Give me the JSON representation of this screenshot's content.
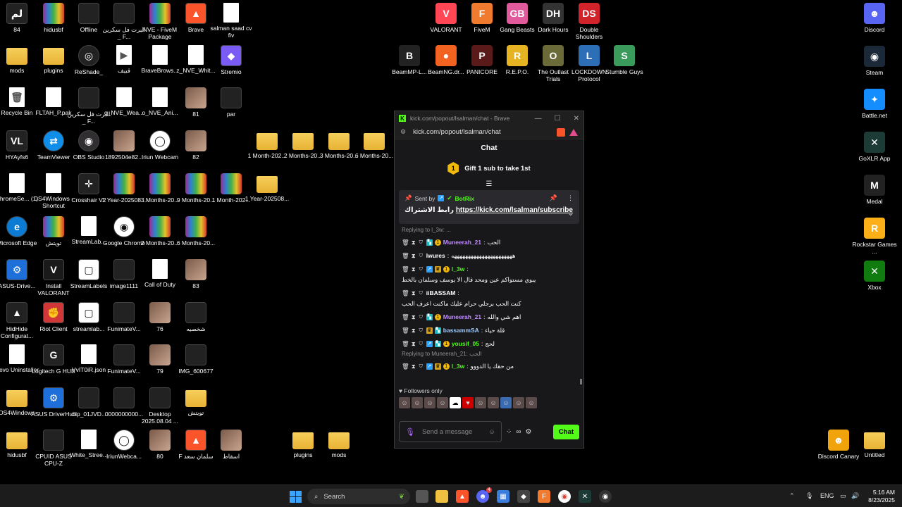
{
  "desktop": {
    "icons_left": [
      {
        "label": "84",
        "glyph": "لم",
        "type": "dark"
      },
      {
        "label": "hidusbf",
        "glyph": "",
        "type": "rar"
      },
      {
        "label": "Offline",
        "glyph": "",
        "type": "dark"
      },
      {
        "label": "البرت فل سكرين _ F...",
        "glyph": "",
        "type": "dark"
      },
      {
        "label": "NVE - FiveM Package",
        "glyph": "",
        "type": "rar"
      },
      {
        "label": "Brave",
        "glyph": "▲",
        "type": "brave"
      },
      {
        "label": "salman saad cv fiv",
        "glyph": "",
        "type": "file"
      },
      {
        "label": "mods",
        "glyph": "",
        "type": "folder"
      },
      {
        "label": "plugins",
        "glyph": "",
        "type": "folder"
      },
      {
        "label": "ReShade_",
        "glyph": "◎",
        "type": "reshade"
      },
      {
        "label": "قبيف",
        "glyph": "▶",
        "type": "file"
      },
      {
        "label": "BraveBrows...",
        "glyph": "",
        "type": "file"
      },
      {
        "label": "z_NVE_Whit...",
        "glyph": "",
        "type": "file"
      },
      {
        "label": "Stremio",
        "glyph": "◆",
        "type": "stremio"
      },
      {
        "label": "Recycle Bin",
        "glyph": "🗑",
        "type": "file"
      },
      {
        "label": "FLTAH_P.pak",
        "glyph": "",
        "type": "file"
      },
      {
        "label": "البرت فل سكرين _ F...",
        "glyph": "",
        "type": "dark"
      },
      {
        "label": "q_NVE_Wea...",
        "glyph": "",
        "type": "file"
      },
      {
        "label": "o_NVE_Ani...",
        "glyph": "",
        "type": "file"
      },
      {
        "label": "81",
        "glyph": "",
        "type": "photo"
      },
      {
        "label": "par",
        "glyph": "",
        "type": "dark"
      },
      {
        "label": "HYAyfs6",
        "glyph": "VL",
        "type": "dark"
      },
      {
        "label": "TeamViewer",
        "glyph": "⇄",
        "type": "teamviewer"
      },
      {
        "label": "OBS Studio",
        "glyph": "◉",
        "type": "obs"
      },
      {
        "label": "1892504e82...",
        "glyph": "",
        "type": "photo"
      },
      {
        "label": "Iriun Webcam",
        "glyph": "◯",
        "type": "iriun"
      },
      {
        "label": "82",
        "glyph": "",
        "type": "photo"
      },
      {
        "label": "ChromeSe... (1)",
        "glyph": "",
        "type": "file"
      },
      {
        "label": "DS4Windows - Shortcut",
        "glyph": "",
        "type": "file"
      },
      {
        "label": "Crosshair V2",
        "glyph": "✛",
        "type": "dark"
      },
      {
        "label": "1 Year-202508...",
        "glyph": "",
        "type": "rar"
      },
      {
        "label": "3 Months-20...",
        "glyph": "",
        "type": "rar"
      },
      {
        "label": "9 Months-20...",
        "glyph": "",
        "type": "rar"
      },
      {
        "label": "1 Month-202...",
        "glyph": "",
        "type": "rar"
      },
      {
        "label": "1 Year-202508...",
        "glyph": "",
        "type": "folder"
      },
      {
        "label": "Microsoft Edge",
        "glyph": "e",
        "type": "edge"
      },
      {
        "label": "تويتش",
        "glyph": "",
        "type": "rar"
      },
      {
        "label": "StreamLab...",
        "glyph": "",
        "type": "file"
      },
      {
        "label": "Google Chrome",
        "glyph": "◉",
        "type": "chrome"
      },
      {
        "label": "2 Months-20...",
        "glyph": "",
        "type": "rar"
      },
      {
        "label": "6 Months-20...",
        "glyph": "",
        "type": "rar"
      },
      {
        "label": "ASUS-Drive...",
        "glyph": "⚙",
        "type": "asus"
      },
      {
        "label": "Install VALORANT",
        "glyph": "V",
        "type": "valorant"
      },
      {
        "label": "StreamLabels",
        "glyph": "▢",
        "type": "streamlabs"
      },
      {
        "label": "image1111",
        "glyph": "",
        "type": "dark"
      },
      {
        "label": "Call of Duty",
        "glyph": "",
        "type": "file"
      },
      {
        "label": "83",
        "glyph": "",
        "type": "photo"
      },
      {
        "label": "HidHide Configurat...",
        "glyph": "▲",
        "type": "dark"
      },
      {
        "label": "Riot Client",
        "glyph": "✊",
        "type": "riot"
      },
      {
        "label": "streamlab...",
        "glyph": "▢",
        "type": "streamlabs"
      },
      {
        "label": "FunimateV...",
        "glyph": "",
        "type": "dark"
      },
      {
        "label": "76",
        "glyph": "",
        "type": "photo"
      },
      {
        "label": "شخصيه",
        "glyph": "",
        "type": "dark"
      },
      {
        "label": "Revo Uninstaller",
        "glyph": "",
        "type": "file"
      },
      {
        "label": "Logitech G HUB",
        "glyph": "G",
        "type": "dark"
      },
      {
        "label": "VvIT0iR.json",
        "glyph": "",
        "type": "file"
      },
      {
        "label": "FunimateV...",
        "glyph": "",
        "type": "dark"
      },
      {
        "label": "79",
        "glyph": "",
        "type": "photo"
      },
      {
        "label": "IMG_600677",
        "glyph": "",
        "type": "dark"
      },
      {
        "label": "DS4Windows",
        "glyph": "",
        "type": "folder"
      },
      {
        "label": "ASUS DriverHub",
        "glyph": "⚙",
        "type": "asus"
      },
      {
        "label": "clip_01JVD...",
        "glyph": "",
        "type": "dark"
      },
      {
        "label": "0000000000...",
        "glyph": "",
        "type": "dark"
      },
      {
        "label": "Desktop 2025.08.04 ...",
        "glyph": "",
        "type": "dark"
      },
      {
        "label": "تويتش",
        "glyph": "",
        "type": "folder"
      },
      {
        "label": "hidusbf",
        "glyph": "",
        "type": "folder"
      },
      {
        "label": "CPUID ASUS CPU-Z",
        "glyph": "",
        "type": "dark"
      },
      {
        "label": "White_Stree...",
        "glyph": "",
        "type": "file"
      },
      {
        "label": "IriunWebca...",
        "glyph": "◯",
        "type": "iriun"
      },
      {
        "label": "80",
        "glyph": "",
        "type": "photo"
      },
      {
        "label": "F سلمان سعد",
        "glyph": "▲",
        "type": "brave"
      },
      {
        "label": "اسقاط",
        "glyph": "",
        "type": "photo"
      }
    ],
    "icons_mid_folders": [
      {
        "label": "1 Month-202..."
      },
      {
        "label": "2 Months-20..."
      },
      {
        "label": "3 Months-20..."
      },
      {
        "label": "6 Months-20..."
      }
    ],
    "icons_bottom_folders": [
      {
        "label": "plugins"
      },
      {
        "label": "mods"
      }
    ],
    "icons_games": [
      {
        "label": "VALORANT",
        "glyph": "V",
        "color": "#ff4655"
      },
      {
        "label": "FiveM",
        "glyph": "F",
        "color": "#f07b2e"
      },
      {
        "label": "Gang Beasts",
        "glyph": "GB",
        "color": "#e05a9c"
      },
      {
        "label": "Dark Hours",
        "glyph": "DH",
        "color": "#333333"
      },
      {
        "label": "Double Shoulders",
        "glyph": "DS",
        "color": "#d0232a"
      },
      {
        "label": "BeamMP-L...",
        "glyph": "B",
        "color": "#222222"
      },
      {
        "label": "BeamNG.dr...",
        "glyph": "●",
        "color": "#f26322"
      },
      {
        "label": "PANICORE",
        "glyph": "P",
        "color": "#5a1a1a"
      },
      {
        "label": "R.E.P.O.",
        "glyph": "R",
        "color": "#e6b422"
      },
      {
        "label": "The Outlast Trials",
        "glyph": "O",
        "color": "#6b6b3a"
      },
      {
        "label": "LOCKDOWN Protocol",
        "glyph": "L",
        "color": "#2d6fb7"
      },
      {
        "label": "Stumble Guys",
        "glyph": "S",
        "color": "#3a9b5c"
      }
    ],
    "icons_right": [
      {
        "label": "Discord",
        "glyph": "☻",
        "color": "#5865f2"
      },
      {
        "label": "Steam",
        "glyph": "◉",
        "color": "#1b2838"
      },
      {
        "label": "Battle.net",
        "glyph": "✦",
        "color": "#148eff"
      },
      {
        "label": "GoXLR App",
        "glyph": "✕",
        "color": "#1d3b36"
      },
      {
        "label": "Medal",
        "glyph": "M",
        "color": "#222222"
      },
      {
        "label": "Rockstar Games ...",
        "glyph": "R",
        "color": "#fcaf17"
      },
      {
        "label": "Xbox",
        "glyph": "✕",
        "color": "#107c10"
      }
    ],
    "icons_bottom_right": [
      {
        "label": "Discord Canary",
        "glyph": "☻",
        "color": "#f0a30a"
      },
      {
        "label": "Untitled",
        "glyph": "",
        "color": "folder"
      }
    ]
  },
  "browser": {
    "title": "kick.com/popout/lsalman/chat - Brave",
    "url": "kick.com/popout/lsalman/chat",
    "min": "—",
    "max": "☐",
    "close": "✕"
  },
  "chat": {
    "header": "Chat",
    "gift_text": "Gift 1 sub to take 1st",
    "gift_badge": "1",
    "pinned": {
      "sent_by": "Sent by",
      "bot_name": "BotRix",
      "prefix": "رابط الاشتراك",
      "link": "https://kick.com/lsalman/subscribe"
    },
    "reply_top": "Replying to l_3w: ...",
    "messages": [
      {
        "user": "Muneerah_21",
        "color": "#c08cff",
        "text": "الحب",
        "badges": [
          "mod",
          "og",
          "sub"
        ]
      },
      {
        "user": "lwures",
        "color": "#ffffff",
        "text": "ههههههههههههههههههههههه",
        "badges": [
          "mod"
        ]
      },
      {
        "user": "l_3w",
        "color": "#53fc18",
        "text": "يبوي مستواكم عين ومحد قال الا يوسف وسلمان بالخط",
        "badges": [
          "mod",
          "vip",
          "crown",
          "sub"
        ]
      },
      {
        "user": "iiBASSAM",
        "color": "#ffffff",
        "text": "كنت الحب برجلي حرام عليك ماكنت اعرف الحب",
        "badges": [
          "mod"
        ]
      },
      {
        "user": "Muneerah_21",
        "color": "#c08cff",
        "text": "اهم شي والله",
        "badges": [
          "mod",
          "og",
          "sub"
        ]
      },
      {
        "user": "bassammSA",
        "color": "#9ecbff",
        "text": "قلة حياء",
        "badges": [
          "mod",
          "crown",
          "og"
        ]
      },
      {
        "user": "yousif_05",
        "color": "#53fc18",
        "text": "لحج",
        "badges": [
          "mod",
          "vip",
          "og",
          "sub"
        ]
      }
    ],
    "reply_bottom": "Replying to Muneerah_21: الحب",
    "last_message": {
      "user": "l_3w",
      "color": "#53fc18",
      "text": "من حقك يا الدووو",
      "badges": [
        "mod",
        "vip",
        "crown",
        "sub"
      ]
    },
    "followers_only": "Followers only",
    "input_placeholder": "Send a message",
    "send_label": "Chat"
  },
  "taskbar": {
    "search_placeholder": "Search",
    "lang": "ENG",
    "time": "5:16 AM",
    "date": "8/23/2025",
    "discord_badge": "4"
  }
}
